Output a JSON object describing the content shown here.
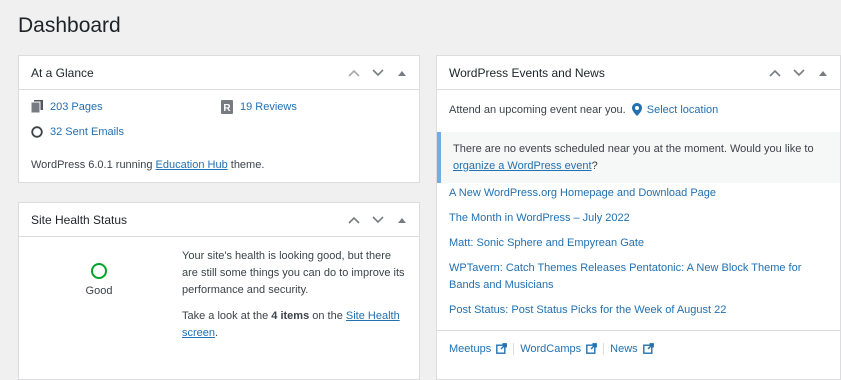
{
  "page": {
    "title": "Dashboard"
  },
  "at_a_glance": {
    "title": "At a Glance",
    "pages_label": "203 Pages",
    "reviews_label": "19 Reviews",
    "emails_label": "32 Sent Emails",
    "footer_prefix": "WordPress 6.0.1 running ",
    "theme_link": "Education Hub",
    "footer_suffix": " theme."
  },
  "site_health": {
    "title": "Site Health Status",
    "status": "Good",
    "status_color": "#00a32a",
    "message": "Your site's health is looking good, but there are still some things you can do to improve its performance and security.",
    "items_prefix": "Take a look at the ",
    "items_count": "4 items",
    "items_middle": " on the ",
    "screen_link": "Site Health screen",
    "items_suffix": "."
  },
  "events_news": {
    "title": "WordPress Events and News",
    "intro": "Attend an upcoming event near you.",
    "select_location": "Select location",
    "notice_text": "There are no events scheduled near you at the moment. Would you like to ",
    "notice_link": "organize a WordPress event",
    "notice_suffix": "?",
    "news": [
      "A New WordPress.org Homepage and Download Page",
      "The Month in WordPress – July 2022",
      "Matt: Sonic Sphere and Empyrean Gate",
      "WPTavern: Catch Themes Releases Pentatonic: A New Block Theme for Bands and Musicians",
      "Post Status: Post Status Picks for the Week of August 22"
    ],
    "footer_links": [
      "Meetups",
      "WordCamps",
      "News"
    ]
  },
  "colors": {
    "link": "#2271b1",
    "notice_border": "#72aee6",
    "good": "#00a32a"
  }
}
